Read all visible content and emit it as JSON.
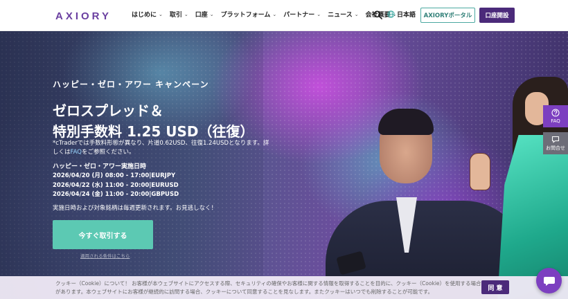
{
  "header": {
    "logo_text": "AXIORY",
    "nav": [
      {
        "label": "はじめに"
      },
      {
        "label": "取引"
      },
      {
        "label": "口座"
      },
      {
        "label": "プラットフォーム"
      },
      {
        "label": "パートナー"
      },
      {
        "label": "ニュース"
      },
      {
        "label": "会社概要"
      }
    ],
    "language": "日本語",
    "portal_button": "AXIORYポータル",
    "open_account_button": "口座開設"
  },
  "hero": {
    "subtitle": "ハッピー・ゼロ・アワー キャンペーン",
    "title_line1": "ゼロスプレッド＆",
    "title_line2": "特別手数料 1.25 USD（往復）",
    "note_part1": "*cTraderでは手数料形態が異なり、片道0.62USD、往復1.24USDとなります。詳しくは",
    "note_link": "FAQ",
    "note_part2": "をご参照ください。",
    "schedule_title": "ハッピー・ゼロ・アワー実施日時",
    "schedule": [
      "2026/04/20 (月) 08:00 - 17:00|EURJPY",
      "2026/04/22 (水) 11:00 - 20:00|EURUSD",
      "2026/04/24 (金) 11:00 - 20:00|GBPUSD"
    ],
    "update_note": "実施日時および対象銘柄は毎週更新されます。お見逃しなく！",
    "cta_button": "今すぐ取引する",
    "terms_link": "適用される条件はこちら"
  },
  "side_tabs": {
    "faq": "FAQ",
    "contact": "お問合せ"
  },
  "cookie": {
    "text": "クッキー（Cookie）について！ お客様が本ウェブサイトにアクセスする際、セキュリティの確保やお客様に関する情報を取得することを目的に、クッキー（Cookie）を使用する場合があります。本ウェブサイトにお客様が継続的に訪問する場合、クッキーについて同意することを見なします。またクッキーはいつでも削除することが可能です。",
    "agree_button": "同 意"
  },
  "icons": {
    "search": "search-icon",
    "globe": "globe-icon",
    "faq": "question-icon",
    "contact": "chat-bubble-icon",
    "chat": "chat-icon"
  },
  "colors": {
    "brand_purple": "#4b2a7a",
    "accent_teal": "#5cc9b3",
    "side_faq": "#7c3fc0"
  }
}
